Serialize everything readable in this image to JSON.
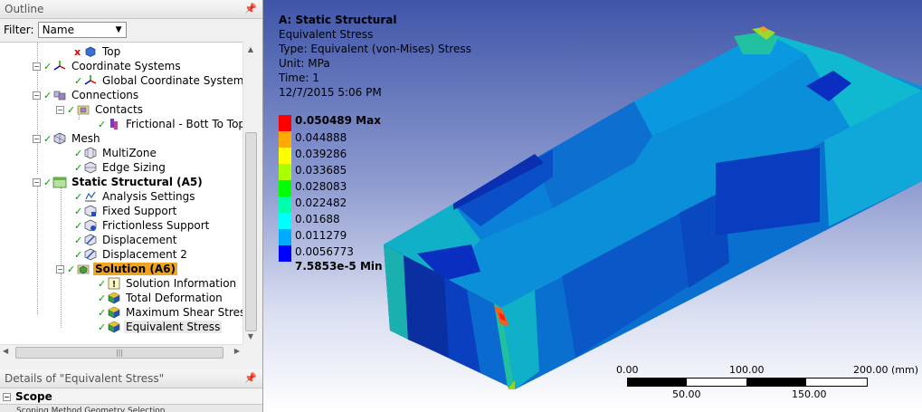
{
  "outline": {
    "title": "Outline",
    "pin": "p",
    "filter_label": "Filter:",
    "filter_value": "Name"
  },
  "tree": {
    "items": [
      {
        "label": "Top"
      },
      {
        "label": "Coordinate Systems"
      },
      {
        "label": "Global Coordinate System"
      },
      {
        "label": "Connections"
      },
      {
        "label": "Contacts"
      },
      {
        "label": "Frictional - Bott To Top"
      },
      {
        "label": "Mesh"
      },
      {
        "label": "MultiZone"
      },
      {
        "label": "Edge Sizing"
      },
      {
        "label": "Static Structural (A5)"
      },
      {
        "label": "Analysis Settings"
      },
      {
        "label": "Fixed Support"
      },
      {
        "label": "Frictionless Support"
      },
      {
        "label": "Displacement"
      },
      {
        "label": "Displacement 2"
      },
      {
        "label": "Solution (A6)"
      },
      {
        "label": "Solution Information"
      },
      {
        "label": "Total Deformation"
      },
      {
        "label": "Maximum Shear Stress"
      },
      {
        "label": "Equivalent Stress"
      }
    ]
  },
  "details": {
    "title": "Details of \"Equivalent Stress\"",
    "scope_label": "Scope",
    "sub_row": "Scoping Method         Geometry Selection"
  },
  "result": {
    "title": "A: Static Structural",
    "subtitle": "Equivalent Stress",
    "type": "Type: Equivalent (von-Mises) Stress",
    "unit": "Unit: MPa",
    "time": "Time: 1",
    "timestamp": "12/7/2015 5:06 PM"
  },
  "legend": {
    "max": "0.050489 Max",
    "levels": [
      "0.044888",
      "0.039286",
      "0.033685",
      "0.028083",
      "0.022482",
      "0.01688",
      "0.011279",
      "0.0056773"
    ],
    "min": "7.5853e-5 Min",
    "colors": [
      "#ff0000",
      "#ffaa00",
      "#ffff00",
      "#aaff00",
      "#00ff00",
      "#00ffaa",
      "#00ffff",
      "#00aaff",
      "#0000ff"
    ]
  },
  "scale": {
    "t0": "0.00",
    "t100": "100.00",
    "t200": "200.00 (mm)",
    "b50": "50.00",
    "b150": "150.00"
  }
}
